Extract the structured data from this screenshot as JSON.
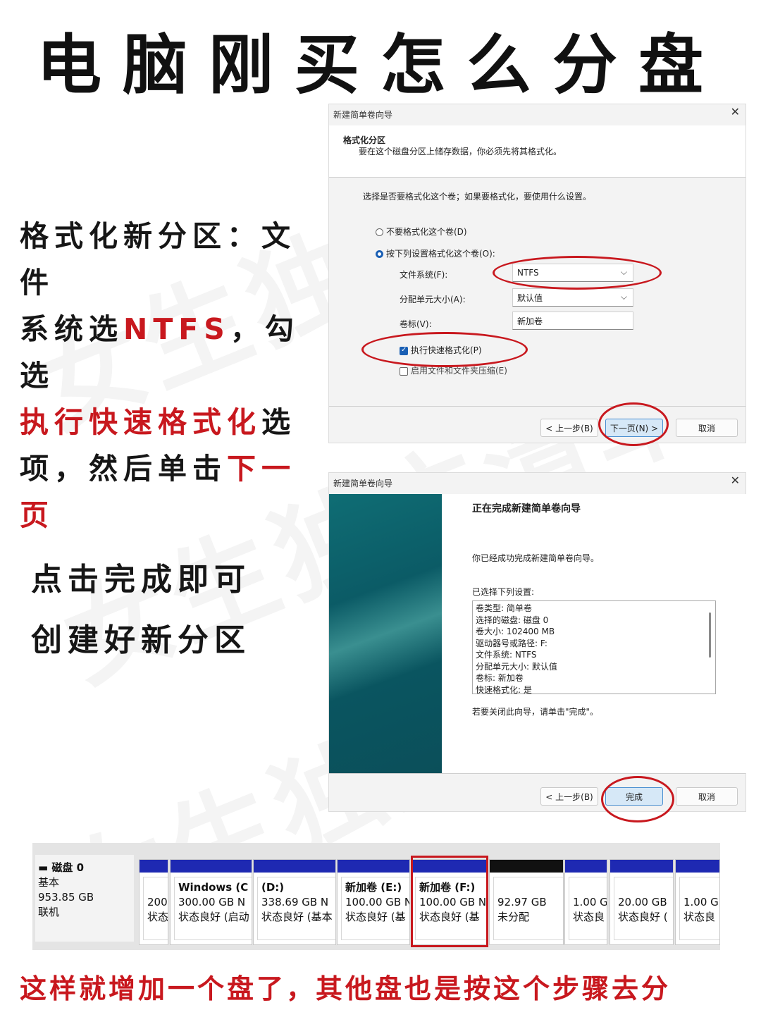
{
  "title": "电脑刚买怎么分盘",
  "watermark": "女生独立清单",
  "step1": {
    "lines": [
      [
        {
          "t": "格式化新分区：文件",
          "red": false
        }
      ],
      [
        {
          "t": "系统选",
          "red": false
        },
        {
          "t": "NTFS",
          "red": true
        },
        {
          "t": "，勾选",
          "red": false
        }
      ],
      [
        {
          "t": "执行快速格式化",
          "red": true
        },
        {
          "t": "选",
          "red": false
        }
      ],
      [
        {
          "t": "项，然后单击",
          "red": false
        },
        {
          "t": "下一页",
          "red": true
        }
      ]
    ]
  },
  "step2": {
    "line1": "点击完成即可",
    "line2": "创建好新分区"
  },
  "dialog1": {
    "title": "新建简单卷向导",
    "close": "✕",
    "header_title": "格式化分区",
    "header_desc": "要在这个磁盘分区上储存数据，你必须先将其格式化。",
    "prompt": "选择是否要格式化这个卷；如果要格式化，要使用什么设置。",
    "radio_no": "不要格式化这个卷(D)",
    "radio_yes": "按下列设置格式化这个卷(O):",
    "fs_label": "文件系统(F):",
    "fs_value": "NTFS",
    "alloc_label": "分配单元大小(A):",
    "alloc_value": "默认值",
    "volume_label": "卷标(V):",
    "volume_value": "新加卷",
    "quick_format": "执行快速格式化(P)",
    "compress": "启用文件和文件夹压缩(E)",
    "back": "< 上一步(B)",
    "next": "下一页(N) >",
    "cancel": "取消"
  },
  "dialog2": {
    "title": "新建简单卷向导",
    "close": "✕",
    "heading": "正在完成新建简单卷向导",
    "success": "你已经成功完成新建简单卷向导。",
    "selected": "已选择下列设置:",
    "settings": [
      "卷类型: 简单卷",
      "选择的磁盘: 磁盘 0",
      "卷大小: 102400 MB",
      "驱动器号或路径: F:",
      "文件系统: NTFS",
      "分配单元大小: 默认值",
      "卷标: 新加卷",
      "快速格式化: 是"
    ],
    "close_hint": "若要关闭此向导，请单击\"完成\"。",
    "back": "< 上一步(B)",
    "finish": "完成",
    "cancel": "取消"
  },
  "disk": {
    "name": "磁盘 0",
    "type": "基本",
    "size": "953.85 GB",
    "status": "联机",
    "partitions": [
      {
        "name": "",
        "size": "200",
        "status": "状态"
      },
      {
        "name": "Windows (C",
        "size": "300.00 GB N",
        "status": "状态良好 (启动"
      },
      {
        "name": "(D:)",
        "size": "338.69 GB N",
        "status": "状态良好 (基本"
      },
      {
        "name": "新加卷 (E:)",
        "size": "100.00 GB N",
        "status": "状态良好 (基"
      },
      {
        "name": "新加卷 (F:)",
        "size": "100.00 GB N",
        "status": "状态良好 (基"
      },
      {
        "name": "",
        "size": "92.97 GB",
        "status": "未分配"
      },
      {
        "name": "",
        "size": "1.00 G",
        "status": "状态良"
      },
      {
        "name": "",
        "size": "20.00 GB",
        "status": "状态良好 ("
      },
      {
        "name": "",
        "size": "1.00 G",
        "status": "状态良"
      }
    ]
  },
  "bottom_note": "这样就增加一个盘了，其他盘也是按这个步骤去分",
  "colors": {
    "accent_red": "#c8181e",
    "partition_bar": "#1e29b2",
    "radio_blue": "#1a5fb4"
  }
}
